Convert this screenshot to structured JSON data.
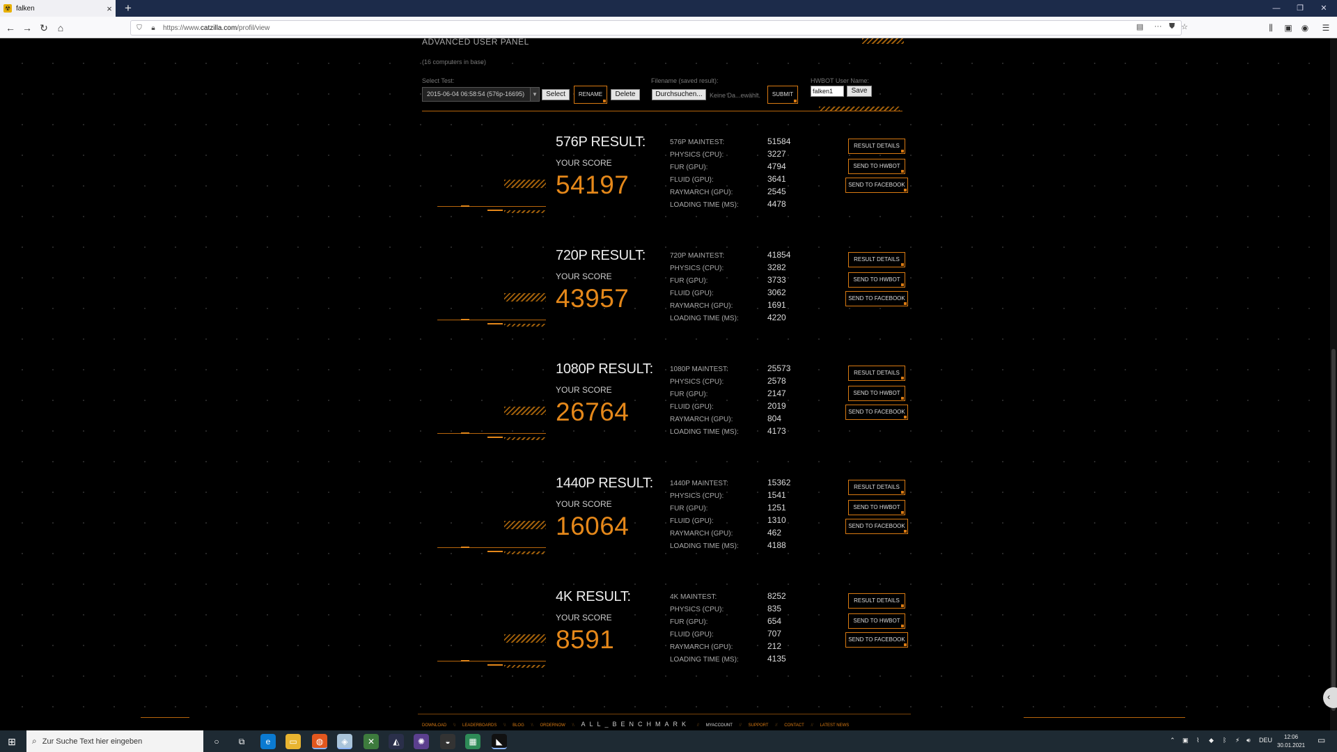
{
  "browser": {
    "tab_title": "falken",
    "tab_close": "×",
    "new_tab": "+",
    "url_prefix": "https://www.",
    "url_domain": "catzilla.com",
    "url_path": "/profil/view"
  },
  "panel": {
    "title": "ADVANCED USER PANEL",
    "computers_note": "(16 computers in base)",
    "select_test_label": "Select Test:",
    "select_test_value": "2015-06-04 06:58:54 (576p-16695)",
    "select_button": "Select",
    "rename_button": "RENAME",
    "delete_button": "Delete",
    "filename_label": "Filename (saved result):",
    "browse_button": "Durchsuchen...",
    "no_file_text": "Keine Da...ewählt.",
    "submit_button": "SUBMIT",
    "hwbot_label": "HWBOT User Name:",
    "hwbot_value": "falken1",
    "save_button": "Save"
  },
  "buttons": {
    "details": "RESULT DETAILS",
    "hwbot": "SEND TO HWBOT",
    "facebook": "SEND TO FACEBOOK"
  },
  "your_score_label": "YOUR SCORE",
  "results": [
    {
      "title": "576P RESULT:",
      "score": "54197",
      "metrics": [
        {
          "label": "576P MAINTEST:",
          "value": "51584"
        },
        {
          "label": "PHYSICS (CPU):",
          "value": "3227"
        },
        {
          "label": "FUR (GPU):",
          "value": "4794"
        },
        {
          "label": "FLUID (GPU):",
          "value": "3641"
        },
        {
          "label": "RAYMARCH (GPU):",
          "value": "2545"
        },
        {
          "label": "LOADING TIME (MS):",
          "value": "4478"
        }
      ]
    },
    {
      "title": "720P RESULT:",
      "score": "43957",
      "metrics": [
        {
          "label": "720P MAINTEST:",
          "value": "41854"
        },
        {
          "label": "PHYSICS (CPU):",
          "value": "3282"
        },
        {
          "label": "FUR (GPU):",
          "value": "3733"
        },
        {
          "label": "FLUID (GPU):",
          "value": "3062"
        },
        {
          "label": "RAYMARCH (GPU):",
          "value": "1691"
        },
        {
          "label": "LOADING TIME (MS):",
          "value": "4220"
        }
      ]
    },
    {
      "title": "1080P RESULT:",
      "score": "26764",
      "metrics": [
        {
          "label": "1080P MAINTEST:",
          "value": "25573"
        },
        {
          "label": "PHYSICS (CPU):",
          "value": "2578"
        },
        {
          "label": "FUR (GPU):",
          "value": "2147"
        },
        {
          "label": "FLUID (GPU):",
          "value": "2019"
        },
        {
          "label": "RAYMARCH (GPU):",
          "value": "804"
        },
        {
          "label": "LOADING TIME (MS):",
          "value": "4173"
        }
      ]
    },
    {
      "title": "1440P RESULT:",
      "score": "16064",
      "metrics": [
        {
          "label": "1440P MAINTEST:",
          "value": "15362"
        },
        {
          "label": "PHYSICS (CPU):",
          "value": "1541"
        },
        {
          "label": "FUR (GPU):",
          "value": "1251"
        },
        {
          "label": "FLUID (GPU):",
          "value": "1310"
        },
        {
          "label": "RAYMARCH (GPU):",
          "value": "462"
        },
        {
          "label": "LOADING TIME (MS):",
          "value": "4188"
        }
      ]
    },
    {
      "title": "4K RESULT:",
      "score": "8591",
      "metrics": [
        {
          "label": "4K MAINTEST:",
          "value": "8252"
        },
        {
          "label": "PHYSICS (CPU):",
          "value": "835"
        },
        {
          "label": "FUR (GPU):",
          "value": "654"
        },
        {
          "label": "FLUID (GPU):",
          "value": "707"
        },
        {
          "label": "RAYMARCH (GPU):",
          "value": "212"
        },
        {
          "label": "LOADING TIME (MS):",
          "value": "4135"
        }
      ]
    }
  ],
  "footer": {
    "download": "DOWNLOAD",
    "leaderboards": "LEADERBOARDS",
    "blog": "BLOG",
    "ordernow": "ORDERNOW",
    "brand": "ALL_BENCHMARK",
    "myaccount": "MYACCOUNT",
    "support": "SUPPORT",
    "contact": "CONTACT",
    "latest_news": "LATEST NEWS",
    "sep": "\\\\",
    "sep2": "//"
  },
  "taskbar": {
    "search_placeholder": "Zur Suche Text hier eingeben",
    "lang": "DEU",
    "time": "12:06",
    "date": "30.01.2021"
  },
  "colors": {
    "accent": "#e5881a",
    "line": "#b8660c",
    "background": "#000000"
  }
}
